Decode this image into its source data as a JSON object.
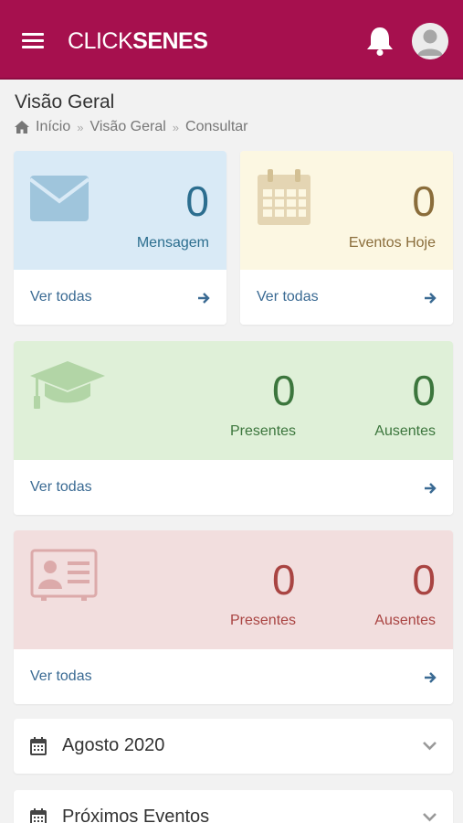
{
  "app": {
    "logo_part1": "CLICK",
    "logo_part2": "SENES",
    "brand_color": "#a6104e"
  },
  "header": {
    "title": "Visão Geral",
    "breadcrumb": [
      "Início",
      "Visão Geral",
      "Consultar"
    ]
  },
  "cards": {
    "messages": {
      "value": "0",
      "label": "Mensagem",
      "link": "Ver todas",
      "icon": "envelope-icon",
      "color": "#2c6e8f",
      "bg": "#d9eaf6"
    },
    "events": {
      "value": "0",
      "label": "Eventos Hoje",
      "link": "Ver todas",
      "icon": "calendar-icon",
      "color": "#8a6d3b",
      "bg": "#fcf7e2"
    },
    "students": {
      "present_value": "0",
      "present_label": "Presentes",
      "absent_value": "0",
      "absent_label": "Ausentes",
      "link": "Ver todas",
      "icon": "graduation-cap-icon",
      "color": "#3c763d",
      "bg": "#dff0d8"
    },
    "staff": {
      "present_value": "0",
      "present_label": "Presentes",
      "absent_value": "0",
      "absent_label": "Ausentes",
      "link": "Ver todas",
      "icon": "id-card-icon",
      "color": "#a94442",
      "bg": "#f2dede"
    }
  },
  "panels": [
    {
      "title": "Agosto 2020",
      "icon": "calendar-icon"
    },
    {
      "title": "Próximos Eventos",
      "icon": "calendar-icon"
    }
  ]
}
